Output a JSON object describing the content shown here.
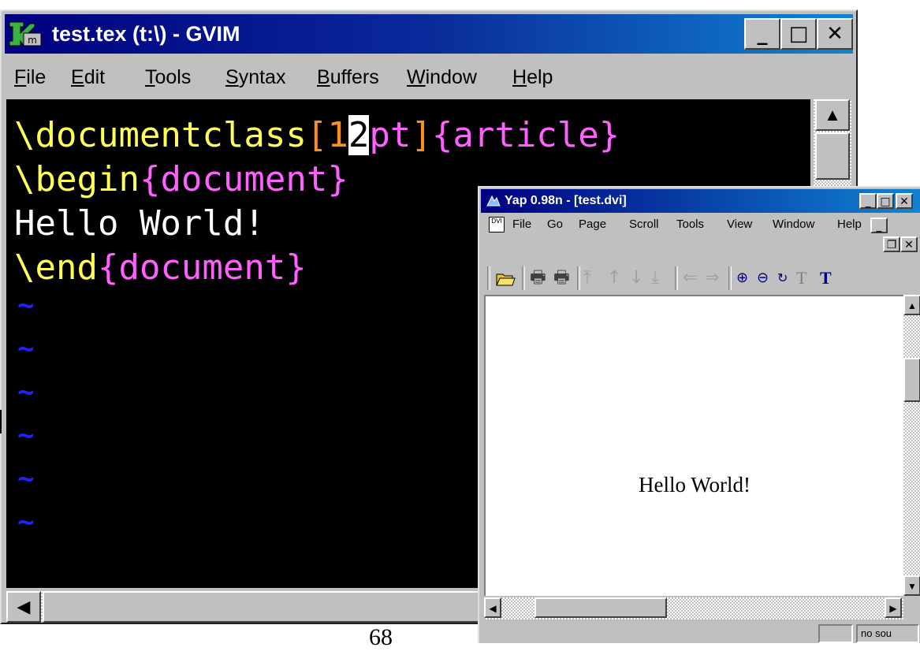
{
  "gvim": {
    "title": "test.tex (t:\\) - GVIM",
    "title_buttons": {
      "minimize": "_",
      "maximize": "□",
      "close": "✕"
    },
    "menu": [
      "File",
      "Edit",
      "Tools",
      "Syntax",
      "Buffers",
      "Window",
      "Help"
    ],
    "menu_mnemonics": [
      "F",
      "E",
      "T",
      "S",
      "B",
      "W",
      "H"
    ],
    "editor": {
      "line1": {
        "cmd": "\\documentclass",
        "lb": "[",
        "pre": "1",
        "cursor": "2",
        "post": "pt",
        "rb": "]",
        "arg": "{article}"
      },
      "line2": {
        "cmd": "\\begin",
        "arg": "{document}"
      },
      "line3": {
        "text": "Hello World!"
      },
      "line4": {
        "cmd": "\\end",
        "arg": "{document}"
      },
      "empty_line_marker": "~"
    },
    "colors": {
      "keyword": "#ffff55",
      "bracket": "#ff9020",
      "argument": "#ff60ff",
      "text": "#ffffff",
      "tilde": "#2020ff"
    }
  },
  "page_number": "68",
  "yap": {
    "title": "Yap 0.98n - [test.dvi]",
    "title_buttons": {
      "minimize": "_",
      "maximize": "□",
      "close": "✕",
      "restore": "❐",
      "doc_close": "✕",
      "doc_minimize": "_"
    },
    "doc_icon_label": "DVI",
    "menu": [
      "File",
      "Go",
      "Page",
      "Scroll",
      "Tools",
      "View",
      "Window",
      "Help"
    ],
    "toolbar_icons": [
      "open-icon",
      "print-icon",
      "print-setup-icon",
      "first-page-icon",
      "previous-page-icon",
      "next-page-icon",
      "last-page-icon",
      "back-icon",
      "forward-icon",
      "zoom-in-icon",
      "zoom-out-icon",
      "refresh-icon",
      "source-special-icon",
      "typewriter-icon"
    ],
    "document_text": "Hello World!",
    "status_source": "no sou"
  }
}
